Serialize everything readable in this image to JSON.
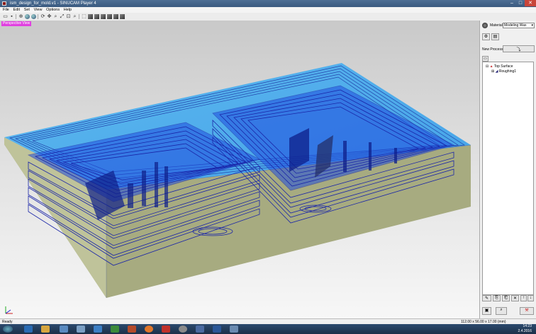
{
  "window": {
    "title": "ism_design_for_mold.v1 - SINUCAM Player 4",
    "minimize": "–",
    "maximize": "□",
    "close": "✕"
  },
  "menu": [
    "File",
    "Edit",
    "Set",
    "View",
    "Options",
    "Help"
  ],
  "viewport": {
    "view_label": "Perspective View",
    "colors": {
      "toolpath": "#2f7dff",
      "toolpath_dark": "#0b2fc8",
      "stock_side": "#a9ad83",
      "stock_front": "#8e9268",
      "stock_top": "#58b8ee"
    }
  },
  "panel": {
    "material_label": "Material",
    "material_value": "Modeling Wax",
    "new_process_label": "New Process",
    "tree": [
      {
        "label": "Top Surface",
        "level": 0
      },
      {
        "label": "Roughing1",
        "level": 1
      }
    ]
  },
  "status": {
    "left": "Ready",
    "right": "112.00 x 56.00 x 17.00 (mm)"
  },
  "taskbar": {
    "time": "14:23",
    "date": "2.4.2016"
  }
}
